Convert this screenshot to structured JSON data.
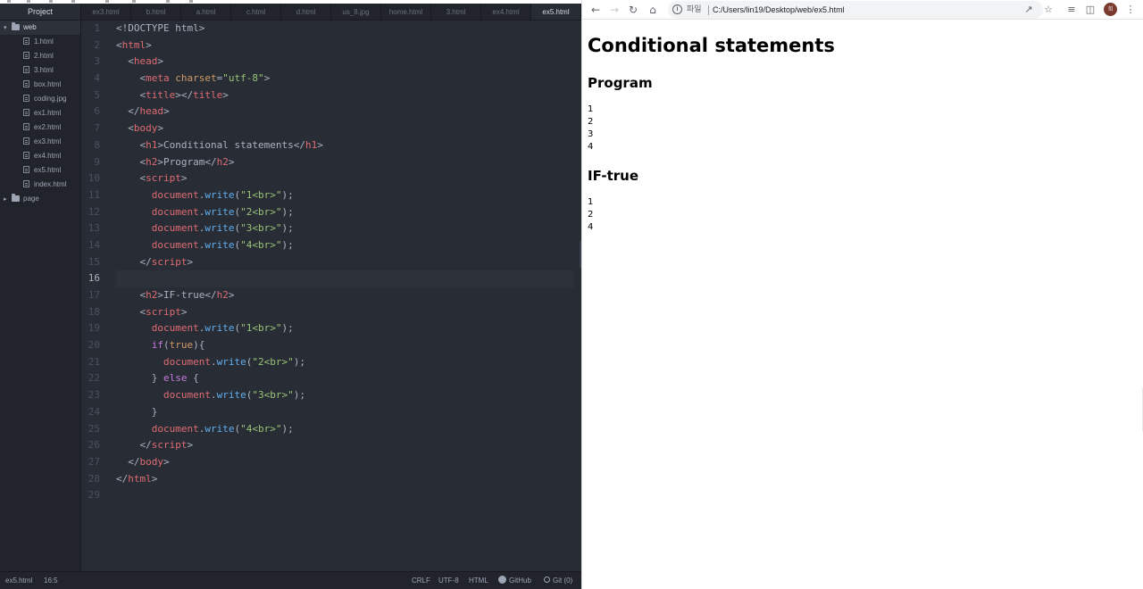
{
  "editor": {
    "sidebar_title": "Project",
    "tree": [
      {
        "type": "dir",
        "name": "web",
        "open": true,
        "selected": true
      },
      {
        "type": "file",
        "name": "1.html"
      },
      {
        "type": "file",
        "name": "2.html"
      },
      {
        "type": "file",
        "name": "3.html"
      },
      {
        "type": "file",
        "name": "box.html"
      },
      {
        "type": "file",
        "name": "coding.jpg"
      },
      {
        "type": "file",
        "name": "ex1.html"
      },
      {
        "type": "file",
        "name": "ex2.html"
      },
      {
        "type": "file",
        "name": "ex3.html"
      },
      {
        "type": "file",
        "name": "ex4.html"
      },
      {
        "type": "file",
        "name": "ex5.html"
      },
      {
        "type": "file",
        "name": "index.html"
      },
      {
        "type": "dir",
        "name": "page",
        "open": false,
        "selected": false
      }
    ],
    "tabs": [
      "ex3.html",
      "b.html",
      "a.html",
      "c.html",
      "d.html",
      "us_8.jpg",
      "home.html",
      "3.html",
      "ex4.html",
      "ex5.html"
    ],
    "active_tab": "ex5.html",
    "current_line": 16,
    "code_lines": [
      [
        [
          "pl",
          "<!DOCTYPE html>"
        ]
      ],
      [
        [
          "pl",
          "<"
        ],
        [
          "tg",
          "html"
        ],
        [
          "pl",
          ">"
        ]
      ],
      [
        [
          "pl",
          "  <"
        ],
        [
          "tg",
          "head"
        ],
        [
          "pl",
          ">"
        ]
      ],
      [
        [
          "pl",
          "    <"
        ],
        [
          "tg",
          "meta"
        ],
        [
          "pl",
          " "
        ],
        [
          "at",
          "charset"
        ],
        [
          "pl",
          "="
        ],
        [
          "st",
          "\"utf-8\""
        ],
        [
          "pl",
          ">"
        ]
      ],
      [
        [
          "pl",
          "    <"
        ],
        [
          "tg",
          "title"
        ],
        [
          "pl",
          "></"
        ],
        [
          "tg",
          "title"
        ],
        [
          "pl",
          ">"
        ]
      ],
      [
        [
          "pl",
          "  </"
        ],
        [
          "tg",
          "head"
        ],
        [
          "pl",
          ">"
        ]
      ],
      [
        [
          "pl",
          "  <"
        ],
        [
          "tg",
          "body"
        ],
        [
          "pl",
          ">"
        ]
      ],
      [
        [
          "pl",
          "    <"
        ],
        [
          "tg",
          "h1"
        ],
        [
          "pl",
          ">Conditional statements</"
        ],
        [
          "tg",
          "h1"
        ],
        [
          "pl",
          ">"
        ]
      ],
      [
        [
          "pl",
          "    <"
        ],
        [
          "tg",
          "h2"
        ],
        [
          "pl",
          ">Program</"
        ],
        [
          "tg",
          "h2"
        ],
        [
          "pl",
          ">"
        ]
      ],
      [
        [
          "pl",
          "    <"
        ],
        [
          "tg",
          "script"
        ],
        [
          "pl",
          ">"
        ]
      ],
      [
        [
          "pl",
          "      "
        ],
        [
          "tg",
          "document"
        ],
        [
          "pl",
          "."
        ],
        [
          "fn",
          "write"
        ],
        [
          "pl",
          "("
        ],
        [
          "st",
          "\"1<br>\""
        ],
        [
          "pl",
          ");"
        ]
      ],
      [
        [
          "pl",
          "      "
        ],
        [
          "tg",
          "document"
        ],
        [
          "pl",
          "."
        ],
        [
          "fn",
          "write"
        ],
        [
          "pl",
          "("
        ],
        [
          "st",
          "\"2<br>\""
        ],
        [
          "pl",
          ");"
        ]
      ],
      [
        [
          "pl",
          "      "
        ],
        [
          "tg",
          "document"
        ],
        [
          "pl",
          "."
        ],
        [
          "fn",
          "write"
        ],
        [
          "pl",
          "("
        ],
        [
          "st",
          "\"3<br>\""
        ],
        [
          "pl",
          ");"
        ]
      ],
      [
        [
          "pl",
          "      "
        ],
        [
          "tg",
          "document"
        ],
        [
          "pl",
          "."
        ],
        [
          "fn",
          "write"
        ],
        [
          "pl",
          "("
        ],
        [
          "st",
          "\"4<br>\""
        ],
        [
          "pl",
          ");"
        ]
      ],
      [
        [
          "pl",
          "    </"
        ],
        [
          "tg",
          "script"
        ],
        [
          "pl",
          ">"
        ]
      ],
      [
        [
          "pl",
          ""
        ]
      ],
      [
        [
          "pl",
          "    <"
        ],
        [
          "tg",
          "h2"
        ],
        [
          "pl",
          ">IF-true</"
        ],
        [
          "tg",
          "h2"
        ],
        [
          "pl",
          ">"
        ]
      ],
      [
        [
          "pl",
          "    <"
        ],
        [
          "tg",
          "script"
        ],
        [
          "pl",
          ">"
        ]
      ],
      [
        [
          "pl",
          "      "
        ],
        [
          "tg",
          "document"
        ],
        [
          "pl",
          "."
        ],
        [
          "fn",
          "write"
        ],
        [
          "pl",
          "("
        ],
        [
          "st",
          "\"1<br>\""
        ],
        [
          "pl",
          ");"
        ]
      ],
      [
        [
          "pl",
          "      "
        ],
        [
          "kw",
          "if"
        ],
        [
          "pl",
          "("
        ],
        [
          "at",
          "true"
        ],
        [
          "pl",
          "){"
        ]
      ],
      [
        [
          "pl",
          "        "
        ],
        [
          "tg",
          "document"
        ],
        [
          "pl",
          "."
        ],
        [
          "fn",
          "write"
        ],
        [
          "pl",
          "("
        ],
        [
          "st",
          "\"2<br>\""
        ],
        [
          "pl",
          ");"
        ]
      ],
      [
        [
          "pl",
          "      } "
        ],
        [
          "kw",
          "else"
        ],
        [
          "pl",
          " {"
        ]
      ],
      [
        [
          "pl",
          "        "
        ],
        [
          "tg",
          "document"
        ],
        [
          "pl",
          "."
        ],
        [
          "fn",
          "write"
        ],
        [
          "pl",
          "("
        ],
        [
          "st",
          "\"3<br>\""
        ],
        [
          "pl",
          ");"
        ]
      ],
      [
        [
          "pl",
          "      }"
        ]
      ],
      [
        [
          "pl",
          "      "
        ],
        [
          "tg",
          "document"
        ],
        [
          "pl",
          "."
        ],
        [
          "fn",
          "write"
        ],
        [
          "pl",
          "("
        ],
        [
          "st",
          "\"4<br>\""
        ],
        [
          "pl",
          ");"
        ]
      ],
      [
        [
          "pl",
          "    </"
        ],
        [
          "tg",
          "script"
        ],
        [
          "pl",
          ">"
        ]
      ],
      [
        [
          "pl",
          "  </"
        ],
        [
          "tg",
          "body"
        ],
        [
          "pl",
          ">"
        ]
      ],
      [
        [
          "pl",
          "</"
        ],
        [
          "tg",
          "html"
        ],
        [
          "pl",
          ">"
        ]
      ],
      [
        [
          "pl",
          ""
        ]
      ]
    ],
    "status": {
      "file": "ex5.html",
      "cursor": "16:5",
      "line_ending": "CRLF",
      "encoding": "UTF-8",
      "grammar": "HTML",
      "github": "GitHub",
      "git": "Git (0)"
    },
    "colors": {
      "background": "#282c34",
      "tag": "#e06c75",
      "attribute": "#d19a66",
      "string": "#98c379",
      "function": "#61afef",
      "keyword": "#c678dd"
    }
  },
  "browser": {
    "scheme_label": "파일",
    "url": "C:/Users/lin19/Desktop/web/ex5.html",
    "avatar_initial": "희",
    "page": {
      "h1": "Conditional statements",
      "h2_program": "Program",
      "program_output": [
        "1",
        "2",
        "3",
        "4"
      ],
      "h2_iftrue": "IF-true",
      "iftrue_output": [
        "1",
        "2",
        "4"
      ]
    }
  }
}
